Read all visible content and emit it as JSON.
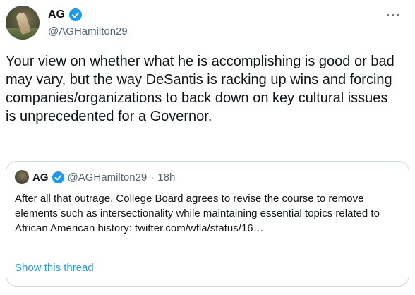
{
  "author": {
    "name": "AG",
    "handle": "@AGHamilton29",
    "verified": true
  },
  "menu": {
    "more_label": "···"
  },
  "tweet": {
    "text": "Your view on whether what he is accomplishing is good or bad may vary, but the way DeSantis is racking up wins and forcing companies/organizations to back down on key cultural issues is unprecedented for a Governor."
  },
  "quoted_tweet": {
    "name": "AG",
    "handle": "@AGHamilton29",
    "separator": "·",
    "time": "18h",
    "text": "After all that outrage, College Board agrees to revise the course to remove elements such as intersectionality while maintaining essential topics related to African American history: twitter.com/wfla/status/16…",
    "show_thread_label": "Show this thread"
  },
  "colors": {
    "text_primary": "#0f1419",
    "text_secondary": "#536471",
    "accent": "#1d9bf0",
    "border": "#cfd9de"
  }
}
